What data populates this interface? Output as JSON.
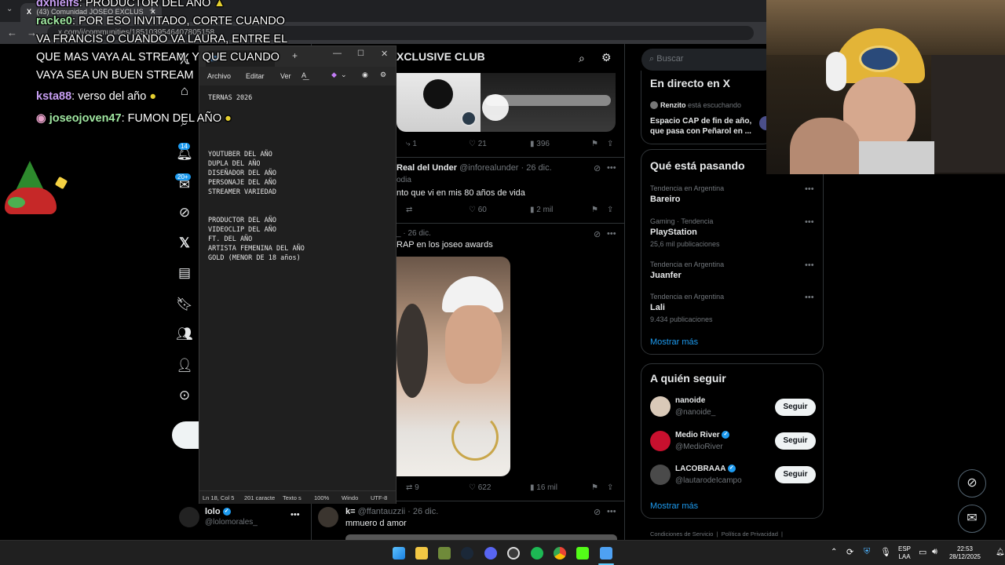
{
  "browser": {
    "tab_title": "(43) Comunidad JOSEO EXCLUS",
    "tab_logo": "X",
    "address": "x.com/i/communities/1851039546407805158",
    "new_tab": "+"
  },
  "chat": {
    "lines": [
      {
        "user": "dxnielfs",
        "msg": ": PRODUCTOR DEL AÑO",
        "color": "#c79ef2"
      },
      {
        "user": "racke0",
        "msg": ": POR ESO INVITADO, CORTE CUANDO",
        "color": "#9fe6a0"
      },
      {
        "user": "",
        "msg": "VA FRANCIS O CUANDO VA LAURA, ENTRE EL",
        "color": "#ffffff"
      },
      {
        "user": "",
        "msg": "QUE MAS VAYA AL STREAM, Y QUE CUANDO",
        "color": "#ffffff"
      },
      {
        "user": "",
        "msg": "VAYA SEA UN BUEN STREAM",
        "color": "#ffffff"
      },
      {
        "user": "ksta88",
        "msg": ": verso del año",
        "color": "#c79ef2"
      },
      {
        "user": "joseojoven47",
        "msg": ": FUMON DEL AÑO",
        "color": "#9fe6a0"
      }
    ]
  },
  "x_nav": {
    "notifications_badge": "14",
    "messages_badge": "20+",
    "post_button": ""
  },
  "feed": {
    "header_title": "XCLUSIVE CLUB",
    "post1": {
      "replies": "1",
      "likes": "21",
      "views": "396"
    },
    "post2": {
      "author": "Real del Under",
      "handle": "@inforealunder · 26 dic.",
      "tag": "odia",
      "text": "nto que vi en mis 80 años de vida",
      "likes": "60",
      "views": "2 mil"
    },
    "post3": {
      "date": "_ · 26 dic.",
      "text": "RAP en los joseo awards",
      "replies": "9",
      "likes": "622",
      "views": "16 mil"
    },
    "post4": {
      "author": "k=",
      "handle": "@ffantauzzii · 26 dic.",
      "text": "mmuero d amor"
    },
    "account": {
      "name": "lolo",
      "handle": "@lolomorales_"
    }
  },
  "sidebar": {
    "search_placeholder": "Buscar",
    "live": {
      "title": "En directo en X",
      "host": "Renzito",
      "host_status": "está escuchando",
      "space_title": "Espacio CAP de fin de año, que pasa con Peñarol en ..."
    },
    "trends": {
      "title": "Qué está pasando",
      "items": [
        {
          "category": "Tendencia en Argentina",
          "name": "Bareiro",
          "count": ""
        },
        {
          "category": "Gaming · Tendencia",
          "name": "PlayStation",
          "count": "25,6 mil publicaciones"
        },
        {
          "category": "Tendencia en Argentina",
          "name": "Juanfer",
          "count": ""
        },
        {
          "category": "Tendencia en Argentina",
          "name": "Lali",
          "count": "9.434 publicaciones"
        }
      ],
      "more": "Mostrar más"
    },
    "follow": {
      "title": "A quién seguir",
      "items": [
        {
          "name": "nanoide",
          "handle": "@nanoide_",
          "button": "Seguir",
          "verified": false
        },
        {
          "name": "Medio River",
          "handle": "@MedioRiver",
          "button": "Seguir",
          "verified": true
        },
        {
          "name": "LACOBRAAA",
          "handle": "@lautarodeIcampo",
          "button": "Seguir",
          "verified": true
        }
      ],
      "more": "Mostrar más"
    },
    "footer": {
      "terms": "Condiciones de Servicio",
      "privacy": "Política de Privacidad"
    }
  },
  "notepad": {
    "tab_title": "* ",
    "menu": {
      "file": "Archivo",
      "edit": "Editar",
      "view": "Ver"
    },
    "content": "TERNAS 2026\n\n\n\n\n\nYOUTUBER DEL AÑO\nDUPLA DEL AÑO\nDISEÑADOR DEL AÑO\nPERSONAJE DEL AÑO\nSTREAMER VARIEDAD\n\n\nPRODUCTOR DEL AÑO\nVIDEOCLIP DEL AÑO\nFT. DEL AÑO\nARTISTA FEMENINA DEL AÑO\nGOLD (MENOR DE 18 años)",
    "status": {
      "position": "Ln 18, Col 5",
      "chars": "201 caracte",
      "format": "Texto s",
      "zoom": "100%",
      "line_ending": "Windo",
      "encoding": "UTF-8"
    }
  },
  "taskbar": {
    "lang": "ESP",
    "lang2": "LAA",
    "time": "22:53",
    "date": "28/12/2025"
  }
}
